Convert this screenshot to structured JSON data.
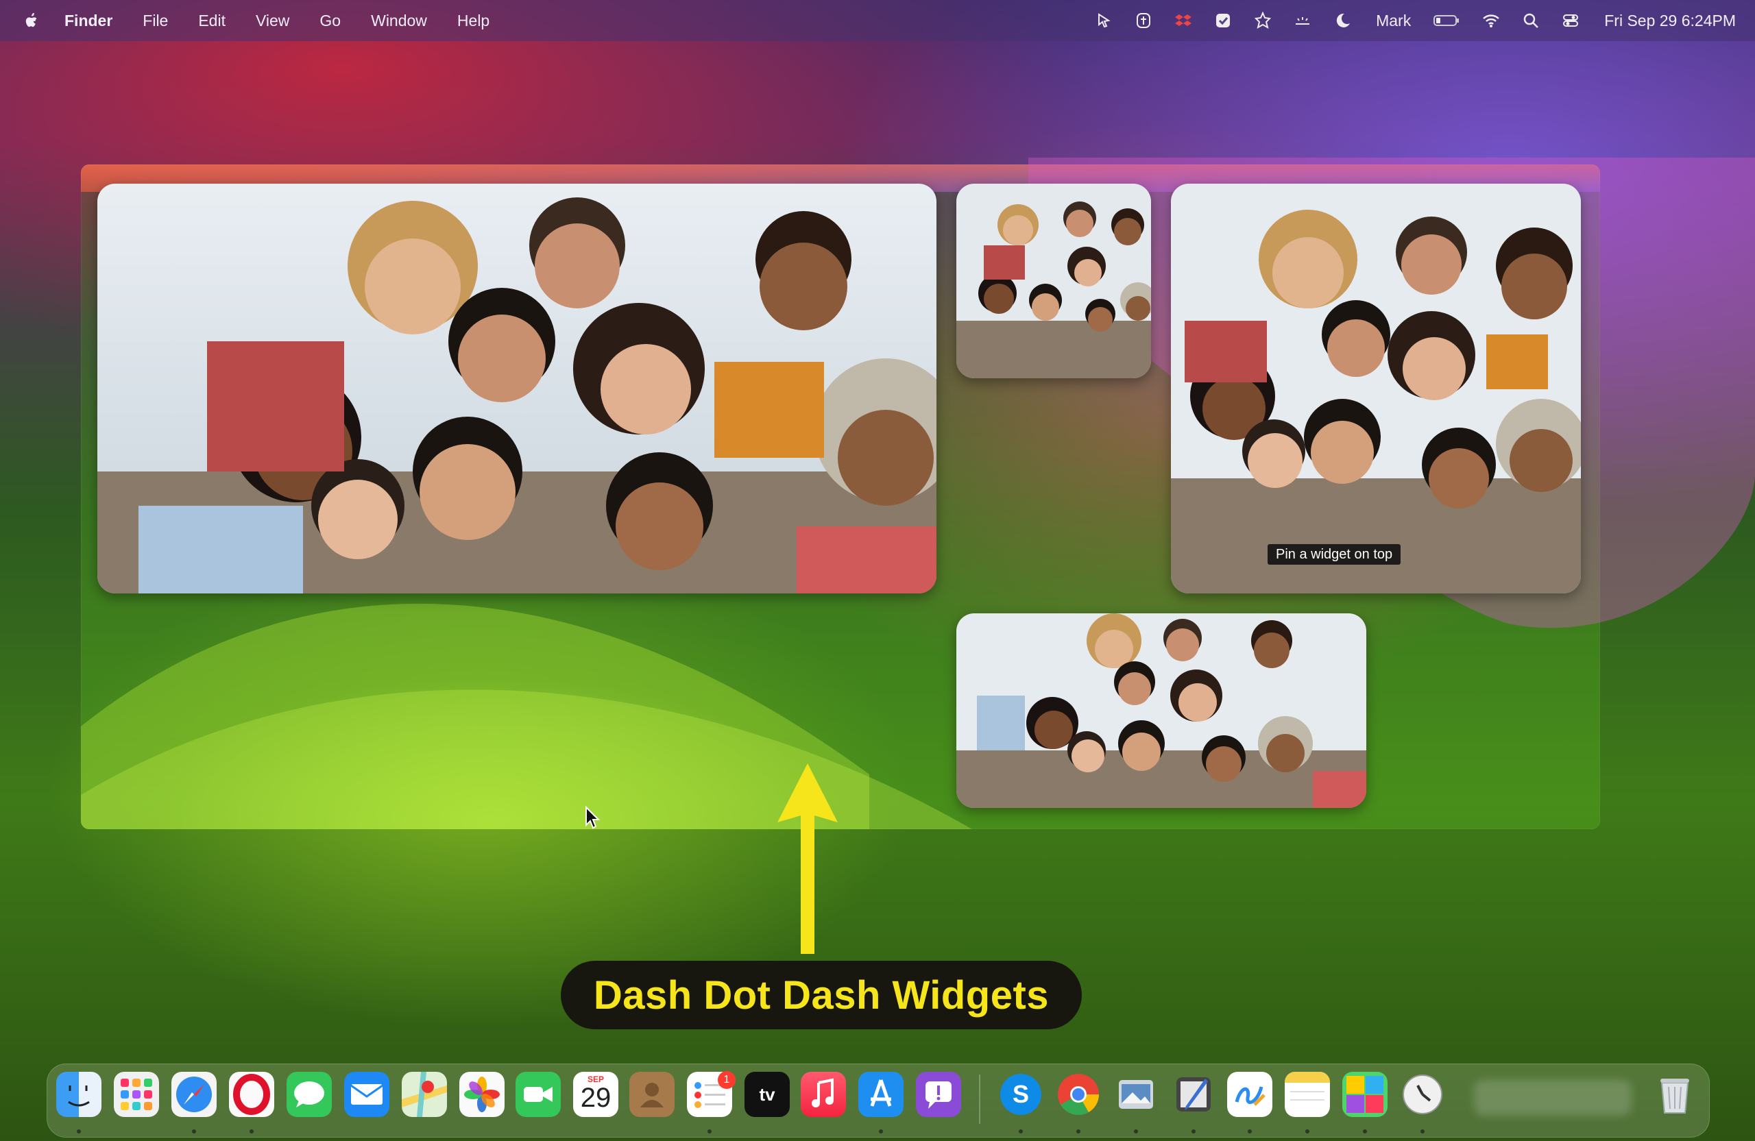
{
  "menubar": {
    "app_name": "Finder",
    "menus": [
      "File",
      "Edit",
      "View",
      "Go",
      "Window",
      "Help"
    ],
    "status_icons": [
      "cursor-icon",
      "ai-icon",
      "dropbox-icon",
      "checkbox-icon",
      "starburst-icon",
      "dots-icon",
      "moon-icon"
    ],
    "user": "Mark",
    "clock": "Fri Sep 29  6:24PM"
  },
  "widgets": {
    "tooltip": "Pin a widget on top"
  },
  "annotation": {
    "caption": "Dash Dot Dash Widgets",
    "arrow_color": "#f6e51b"
  },
  "dock": {
    "apps": [
      "finder-icon",
      "launchpad-icon",
      "safari-icon",
      "opera-icon",
      "messages-icon",
      "mail-icon",
      "maps-icon",
      "photos-icon",
      "facetime-icon",
      "calendar-icon",
      "contacts-icon",
      "reminders-icon",
      "apple-tv-icon",
      "music-icon",
      "app-store-icon",
      "feedback-icon",
      "skype-icon",
      "chrome-icon",
      "preview-icon",
      "script-editor-icon",
      "freeform-icon",
      "notes-icon",
      "widget-app-icon",
      "activity-monitor-icon",
      "trash-icon"
    ],
    "calendar_month": "SEP",
    "calendar_day": "29",
    "reminders_badge": "1",
    "tv_label": "tv"
  }
}
